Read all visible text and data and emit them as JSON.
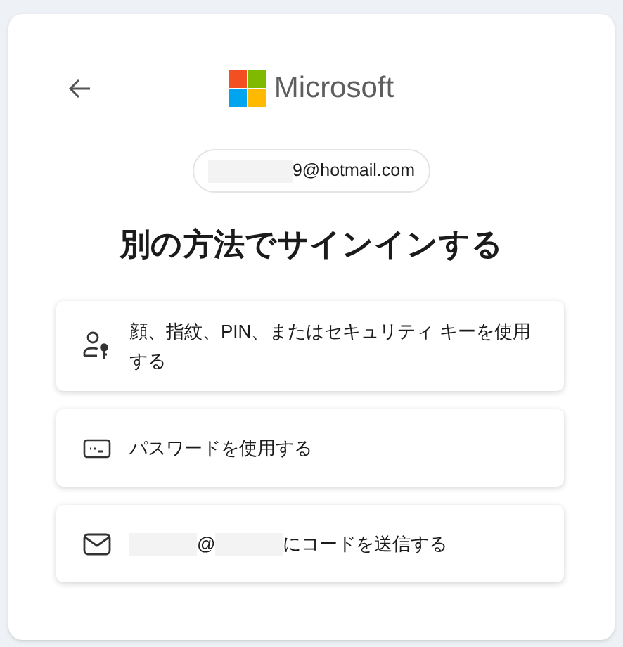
{
  "brand": {
    "name": "Microsoft"
  },
  "account": {
    "segments": [
      {
        "kind": "redacted"
      },
      {
        "kind": "text",
        "text": "9@hotmail.com"
      }
    ]
  },
  "title": "別の方法でサインインする",
  "options": [
    {
      "kind": "passkey",
      "segments": [
        {
          "kind": "text",
          "text": "顔、指紋、PIN、またはセキュリティ キーを使用する"
        }
      ]
    },
    {
      "kind": "password",
      "segments": [
        {
          "kind": "text",
          "text": "パスワードを使用する"
        }
      ]
    },
    {
      "kind": "mail",
      "segments": [
        {
          "kind": "redacted"
        },
        {
          "kind": "text",
          "text": "@"
        },
        {
          "kind": "redacted"
        },
        {
          "kind": "text",
          "text": "にコードを送信する"
        }
      ]
    }
  ]
}
